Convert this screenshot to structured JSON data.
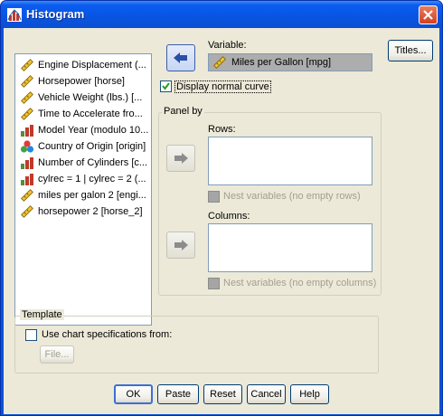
{
  "window": {
    "title": "Histogram"
  },
  "variables": [
    {
      "label": "Engine Displacement (...",
      "icon": "scale-icon"
    },
    {
      "label": "Horsepower [horse]",
      "icon": "scale-icon"
    },
    {
      "label": "Vehicle Weight (lbs.) [...",
      "icon": "scale-icon"
    },
    {
      "label": "Time to Accelerate fro...",
      "icon": "scale-icon"
    },
    {
      "label": "Model Year (modulo 10...",
      "icon": "ordinal-icon"
    },
    {
      "label": "Country of Origin [origin]",
      "icon": "nominal-icon"
    },
    {
      "label": "Number of Cylinders [c...",
      "icon": "ordinal-icon"
    },
    {
      "label": "cylrec = 1 | cylrec = 2 (...",
      "icon": "ordinal-icon"
    },
    {
      "label": "miles per galon 2 [engi...",
      "icon": "scale-icon"
    },
    {
      "label": "horsepower 2 [horse_2]",
      "icon": "scale-icon"
    }
  ],
  "variable_field": {
    "label": "Variable:",
    "value": "Miles per Gallon [mpg]",
    "icon": "scale-icon"
  },
  "display_normal_curve": {
    "label": "Display normal curve",
    "checked": true
  },
  "panel_by": {
    "legend": "Panel by",
    "rows_label": "Rows:",
    "rows_nest": "Nest variables (no empty rows)",
    "columns_label": "Columns:",
    "columns_nest": "Nest variables (no empty columns)"
  },
  "template": {
    "legend": "Template",
    "use_chart_spec": "Use chart specifications from:",
    "file_button": "File..."
  },
  "buttons": {
    "titles": "Titles...",
    "ok": "OK",
    "paste": "Paste",
    "reset": "Reset",
    "cancel": "Cancel",
    "help": "Help"
  },
  "colors": {
    "title_bar": "#0a5cf0",
    "dialog_bg": "#ece9d8",
    "close_button": "#d2401f"
  }
}
